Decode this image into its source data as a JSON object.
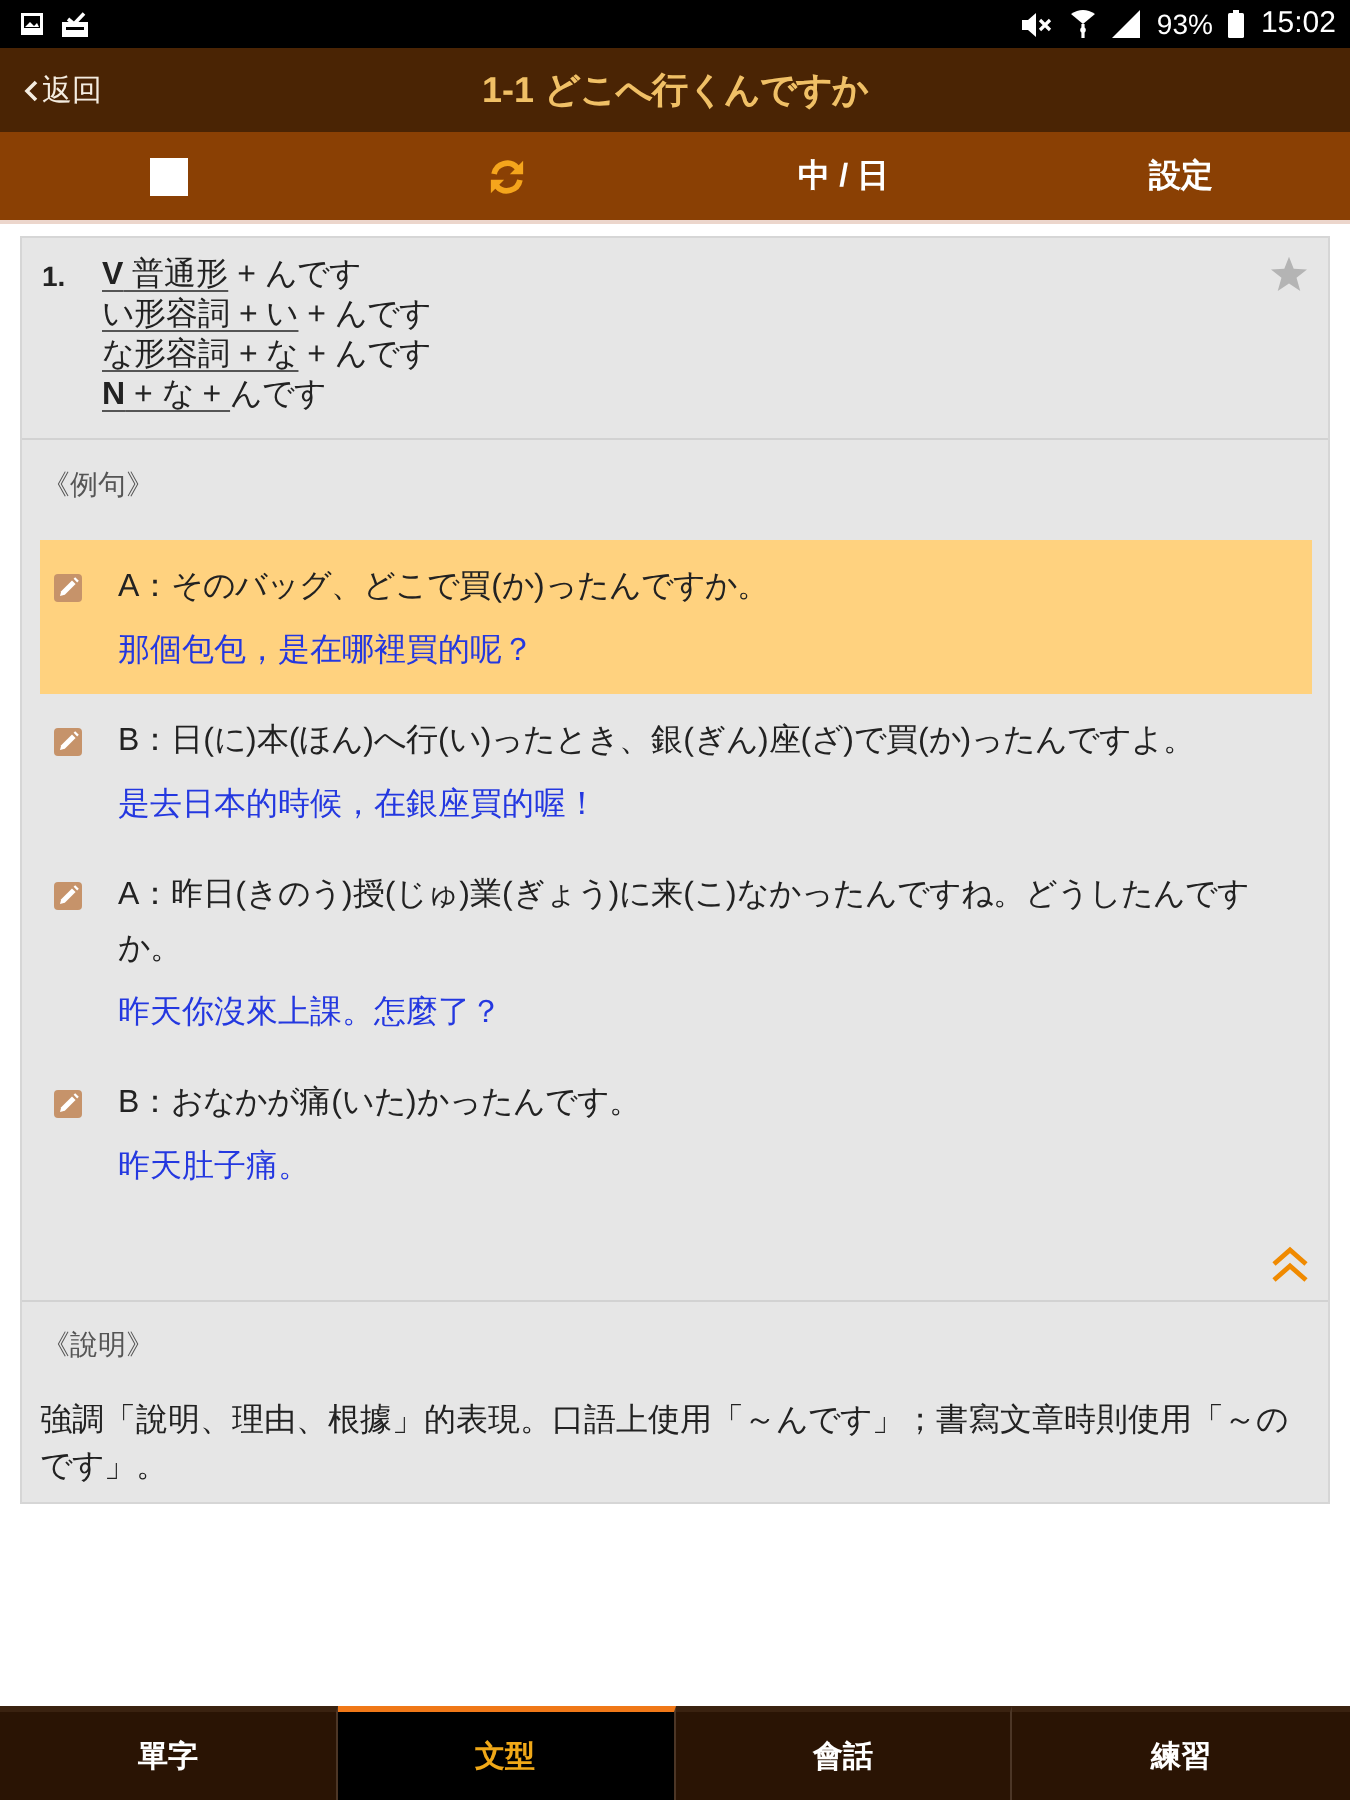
{
  "status_bar": {
    "battery": "93%",
    "time": "15:02"
  },
  "header": {
    "back": "返回",
    "title": "1-1 どこへ行くんですか"
  },
  "toolbar": {
    "language_toggle": "中 / 日",
    "settings": "設定"
  },
  "pattern": {
    "number": "1.",
    "starred": false,
    "lines": [
      {
        "segments": [
          {
            "text": "**V** 普通形",
            "underlined": true
          },
          {
            "text": " + んです",
            "underlined": false
          }
        ]
      },
      {
        "segments": [
          {
            "text": "い形容詞 + い",
            "underlined": true
          },
          {
            "text": " + んです",
            "underlined": false
          }
        ]
      },
      {
        "segments": [
          {
            "text": "な形容詞 + な",
            "underlined": true
          },
          {
            "text": " + んです",
            "underlined": false
          }
        ]
      },
      {
        "segments": [
          {
            "text": "**N** + な + ",
            "underlined": true
          },
          {
            "text": "んです",
            "underlined": false
          }
        ]
      }
    ]
  },
  "examples": {
    "heading": "《例句》",
    "items": [
      {
        "selected": true,
        "japanese": "A：そのバッグ、どこで買(か)ったんですか。",
        "chinese": "那個包包，是在哪裡買的呢？"
      },
      {
        "selected": false,
        "japanese": "B：日(に)本(ほん)へ行(い)ったとき、銀(ぎん)座(ざ)で買(か)ったんですよ。",
        "chinese": "是去日本的時候，在銀座買的喔！"
      },
      {
        "selected": false,
        "japanese": "A：昨日(きのう)授(じゅ)業(ぎょう)に来(こ)なかったんですね。どうしたんですか。",
        "chinese": "昨天你沒來上課。怎麼了？"
      },
      {
        "selected": false,
        "japanese": "B：おなかが痛(いた)かったんです。",
        "chinese": "昨天肚子痛。"
      }
    ]
  },
  "explanation": {
    "heading": "《說明》",
    "text": "強調「說明、理由、根據」的表現。口語上使用「～んです」；書寫文章時則使用「～のです」。"
  },
  "bottom_tabs": [
    {
      "label": "單字",
      "selected": false
    },
    {
      "label": "文型",
      "selected": true
    },
    {
      "label": "會話",
      "selected": false
    },
    {
      "label": "練習",
      "selected": false
    }
  ]
}
